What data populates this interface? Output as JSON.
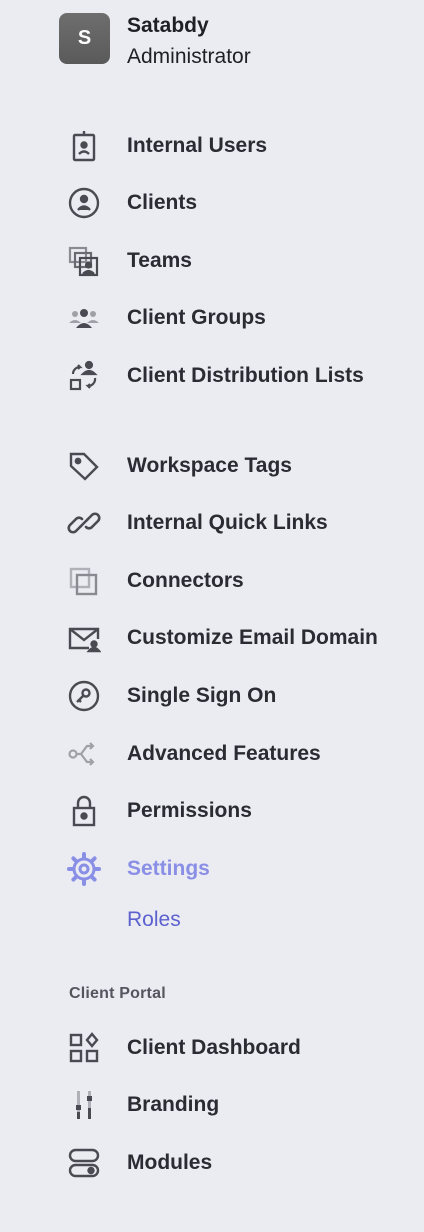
{
  "profile": {
    "initial": "S",
    "name": "Satabdy",
    "role": "Administrator"
  },
  "nav_group_1": [
    {
      "label": "Internal Users",
      "icon": "id-badge-icon"
    },
    {
      "label": "Clients",
      "icon": "user-circle-icon"
    },
    {
      "label": "Teams",
      "icon": "team-stack-icon"
    },
    {
      "label": "Client Groups",
      "icon": "people-group-icon"
    },
    {
      "label": "Client Distribution Lists",
      "icon": "distribution-list-icon"
    }
  ],
  "nav_group_2": [
    {
      "label": "Workspace Tags",
      "icon": "tag-icon"
    },
    {
      "label": "Internal Quick Links",
      "icon": "link-icon"
    },
    {
      "label": "Connectors",
      "icon": "connectors-icon"
    },
    {
      "label": "Customize Email Domain",
      "icon": "email-icon"
    },
    {
      "label": "Single Sign On",
      "icon": "key-circle-icon"
    },
    {
      "label": "Advanced Features",
      "icon": "share-icon"
    },
    {
      "label": "Permissions",
      "icon": "lock-icon"
    },
    {
      "label": "Settings",
      "icon": "gear-icon",
      "active": true
    }
  ],
  "settings_sub": {
    "roles": "Roles"
  },
  "section_client_portal": "Client Portal",
  "nav_group_3": [
    {
      "label": "Client Dashboard",
      "icon": "dashboard-icon"
    },
    {
      "label": "Branding",
      "icon": "branding-sliders-icon"
    },
    {
      "label": "Modules",
      "icon": "modules-toggle-icon"
    }
  ],
  "colors": {
    "active": "#8a8fe6",
    "sub_link": "#5c61cf",
    "background": "#ebebf2",
    "icon": "#4a4a52"
  }
}
